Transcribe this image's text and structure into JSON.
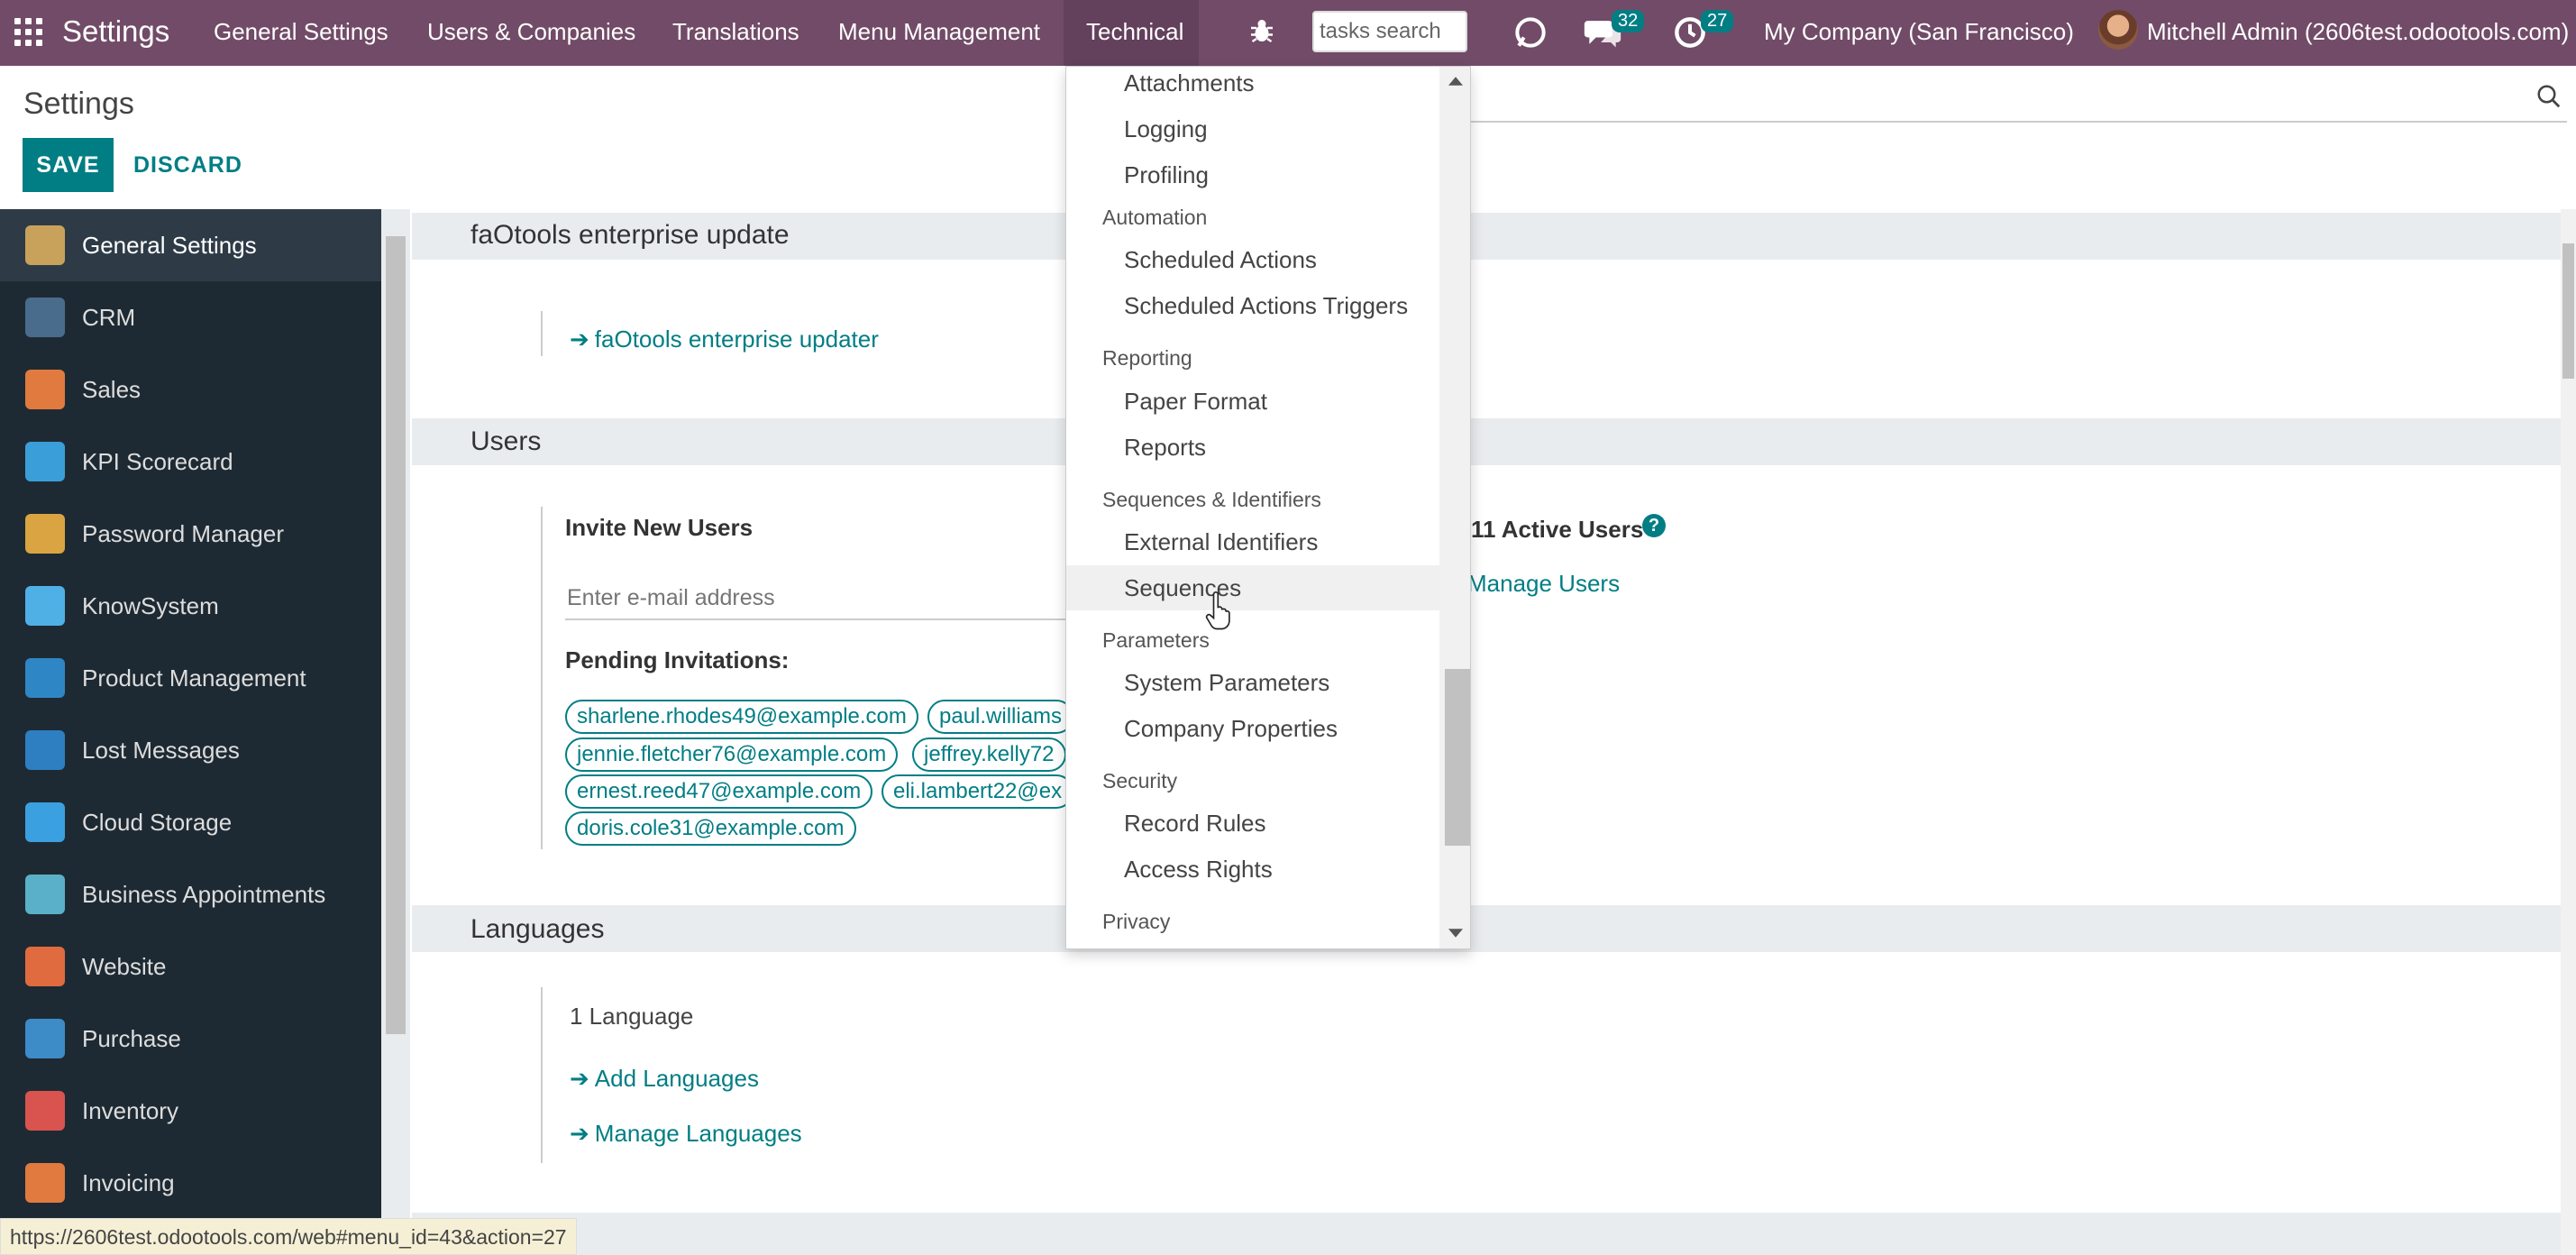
{
  "navbar": {
    "brand": "Settings",
    "menus": [
      "General Settings",
      "Users & Companies",
      "Translations",
      "Menu Management",
      "Technical"
    ],
    "search_value": "tasks search",
    "messages_count": "32",
    "activities_count": "27",
    "company": "My Company (San Francisco)",
    "user": "Mitchell Admin (2606test.odootools.com)"
  },
  "control_panel": {
    "title": "Settings",
    "save_label": "SAVE",
    "discard_label": "DISCARD"
  },
  "sidebar": {
    "items": [
      {
        "label": "General Settings",
        "icon": "gear-icon",
        "color": "#c8a25a"
      },
      {
        "label": "CRM",
        "icon": "handshake-icon",
        "color": "#4a6c8c"
      },
      {
        "label": "Sales",
        "icon": "chart-icon",
        "color": "#e07a3f"
      },
      {
        "label": "KPI Scorecard",
        "icon": "scorecard-icon",
        "color": "#3a9fd8"
      },
      {
        "label": "Password Manager",
        "icon": "key-icon",
        "color": "#d9a441"
      },
      {
        "label": "KnowSystem",
        "icon": "brain-icon",
        "color": "#4fb0e6"
      },
      {
        "label": "Product Management",
        "icon": "product-icon",
        "color": "#2f86c4"
      },
      {
        "label": "Lost Messages",
        "icon": "person-icon",
        "color": "#2d7fc1"
      },
      {
        "label": "Cloud Storage",
        "icon": "cloud-icon",
        "color": "#3aa0e0"
      },
      {
        "label": "Business Appointments",
        "icon": "clock-icon",
        "color": "#5ab0c8"
      },
      {
        "label": "Website",
        "icon": "globe-icon",
        "color": "#e06b3f"
      },
      {
        "label": "Purchase",
        "icon": "card-icon",
        "color": "#3d8bc7"
      },
      {
        "label": "Inventory",
        "icon": "box-icon",
        "color": "#d9534f"
      },
      {
        "label": "Invoicing",
        "icon": "invoice-icon",
        "color": "#e07a3f"
      }
    ]
  },
  "sections": {
    "faotools": {
      "title": "faOtools enterprise update",
      "link": "faOtools enterprise updater"
    },
    "users": {
      "title": "Users",
      "invite_label": "Invite New Users",
      "email_placeholder": "Enter e-mail address",
      "pending_label": "Pending Invitations:",
      "invitations": [
        "sharlene.rhodes49@example.com",
        "paul.williams",
        "jennie.fletcher76@example.com",
        "jeffrey.kelly72",
        "ernest.reed47@example.com",
        "eli.lambert22@ex",
        "doris.cole31@example.com"
      ],
      "active_users": "11 Active Users",
      "manage_users": "Manage Users"
    },
    "languages": {
      "title": "Languages",
      "count": "1 Language",
      "add": "Add Languages",
      "manage": "Manage Languages"
    }
  },
  "dropdown": {
    "groups": [
      {
        "header": null,
        "items": [
          "Attachments",
          "Logging",
          "Profiling"
        ]
      },
      {
        "header": "Automation",
        "items": [
          "Scheduled Actions",
          "Scheduled Actions Triggers"
        ]
      },
      {
        "header": "Reporting",
        "items": [
          "Paper Format",
          "Reports"
        ]
      },
      {
        "header": "Sequences & Identifiers",
        "items": [
          "External Identifiers",
          "Sequences"
        ]
      },
      {
        "header": "Parameters",
        "items": [
          "System Parameters",
          "Company Properties"
        ]
      },
      {
        "header": "Security",
        "items": [
          "Record Rules",
          "Access Rights"
        ]
      },
      {
        "header": "Privacy",
        "items": []
      }
    ]
  },
  "status_bar_url": "https://2606test.odootools.com/web#menu_id=43&action=27",
  "colors": {
    "brand": "#714B67",
    "accent": "#017e84",
    "sidebar": "#1e2a33"
  }
}
